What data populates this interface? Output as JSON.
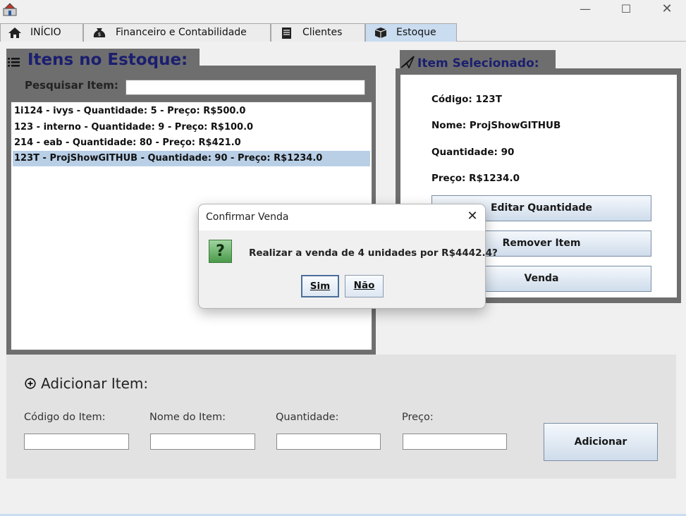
{
  "window": {
    "minimize": "—",
    "maximize": "☐",
    "close": "✕"
  },
  "tabs": [
    {
      "label": "INÍCIO",
      "icon": "home-icon"
    },
    {
      "label": "Financeiro e Contabilidade",
      "icon": "money-bag-icon"
    },
    {
      "label": "Clientes",
      "icon": "document-icon"
    },
    {
      "label": "Estoque",
      "icon": "box-icon",
      "active": true
    }
  ],
  "stock": {
    "title": "Itens no Estoque:",
    "search_label": "Pesquisar Item:",
    "search_value": "",
    "items": [
      "1i124 - ivys - Quantidade: 5 - Preço: R$500.0",
      "123 - interno - Quantidade: 9 - Preço: R$100.0",
      "214 - eab - Quantidade: 80 - Preço: R$421.0",
      "123T - ProjShowGITHUB - Quantidade: 90 - Preço: R$1234.0"
    ],
    "selected_index": 3
  },
  "selected_item": {
    "title": "Item Selecionado:",
    "code": "Código: 123T",
    "name": "Nome: ProjShowGITHUB",
    "quantity": "Quantidade: 90",
    "price": "Preço: R$1234.0",
    "edit_button": "Editar Quantidade",
    "remove_button": "Remover Item",
    "sale_button": "Venda"
  },
  "add_item": {
    "title": "Adicionar Item:",
    "code_label": "Código do Item:",
    "name_label": "Nome do Item:",
    "quantity_label": "Quantidade:",
    "price_label": "Preço:",
    "add_button": "Adicionar"
  },
  "dialog": {
    "title": "Confirmar Venda",
    "message": "Realizar a venda de 4 unidades por R$4442.4?",
    "icon_glyph": "?",
    "yes_button": "Sim",
    "no_button": "Não",
    "close": "✕"
  },
  "colors": {
    "active_tab": "#c9dcf0",
    "panel_frame": "#6e6e6e",
    "heading_text": "#1b1f6e",
    "selection": "#b8cfe6"
  }
}
